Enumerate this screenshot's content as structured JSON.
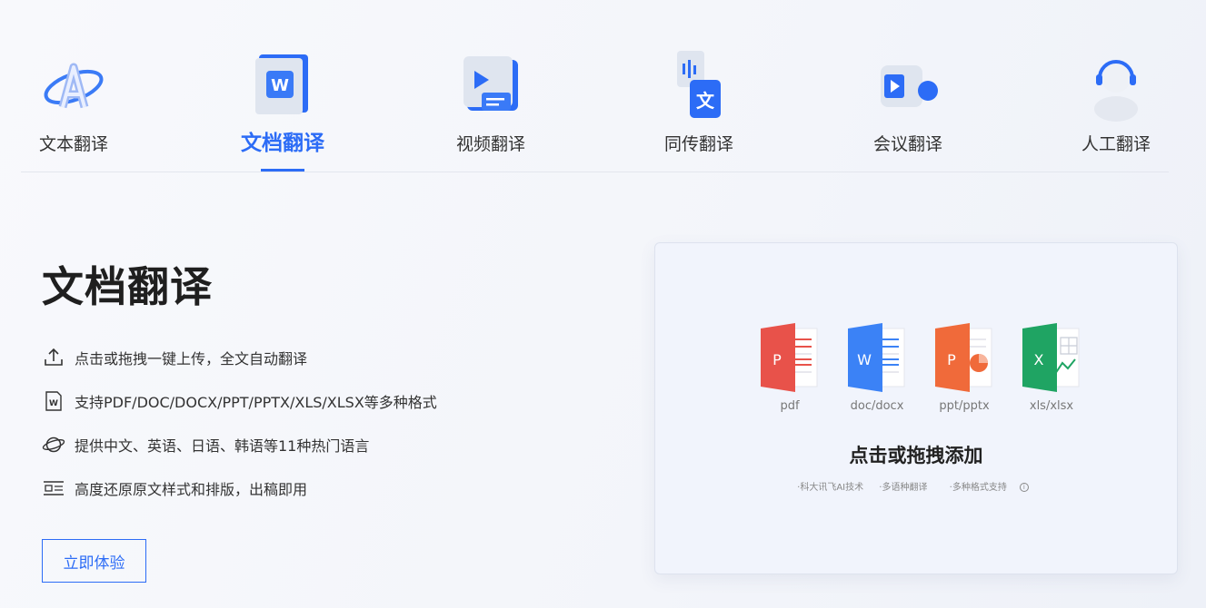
{
  "tabs": [
    {
      "label": "文本翻译",
      "icon": "text-translate-icon",
      "active": false
    },
    {
      "label": "文档翻译",
      "icon": "word-document-icon",
      "active": true
    },
    {
      "label": "视频翻译",
      "icon": "video-play-icon",
      "active": false
    },
    {
      "label": "同传翻译",
      "icon": "speech-translate-icon",
      "active": false
    },
    {
      "label": "会议翻译",
      "icon": "video-camera-icon",
      "active": false
    },
    {
      "label": "人工翻译",
      "icon": "headset-agent-icon",
      "active": false
    }
  ],
  "hero": {
    "title": "文档翻译",
    "features": [
      {
        "icon": "upload-icon",
        "text": "点击或拖拽一键上传，全文自动翻译"
      },
      {
        "icon": "word-file-icon",
        "text": "支持PDF/DOC/DOCX/PPT/PPTX/XLS/XLSX等多种格式"
      },
      {
        "icon": "planet-icon",
        "text": "提供中文、英语、日语、韩语等11种热门语言"
      },
      {
        "icon": "layout-icon",
        "text": "高度还原原文样式和排版，出稿即用"
      }
    ],
    "cta_label": "立即体验"
  },
  "upload": {
    "formats": [
      {
        "name": "pdf",
        "letter": "P",
        "color": "#e8524a"
      },
      {
        "name": "doc/docx",
        "letter": "W",
        "color": "#3b82f6"
      },
      {
        "name": "ppt/pptx",
        "letter": "P",
        "color": "#f06a3a"
      },
      {
        "name": "xls/xlsx",
        "letter": "X",
        "color": "#1fa463"
      }
    ],
    "title": "点击或拖拽添加",
    "notes": [
      "·科大讯飞AI技术",
      "·多语种翻译",
      "·多种格式支持"
    ]
  },
  "colors": {
    "accent": "#2c6cf6"
  }
}
